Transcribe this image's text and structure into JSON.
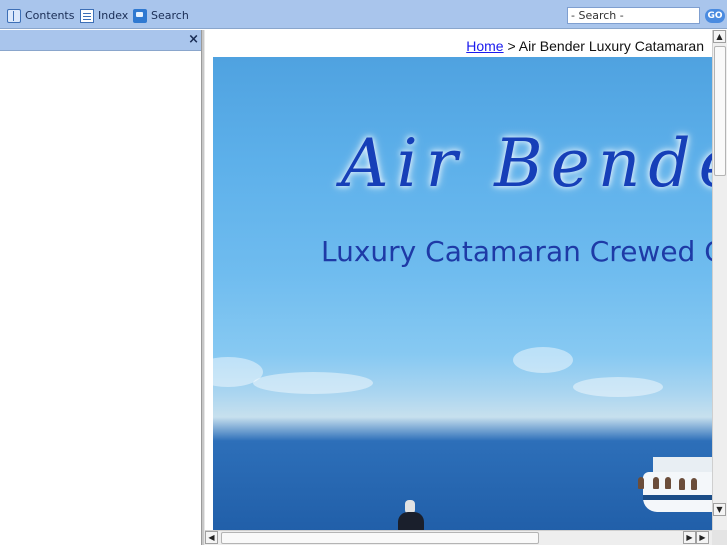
{
  "toolbar": {
    "contents_label": "Contents",
    "index_label": "Index",
    "search_label": "Search",
    "search_placeholder": "- Search -",
    "go_label": "GO"
  },
  "left_panel": {
    "close_symbol": "×"
  },
  "breadcrumb": {
    "home_label": "Home",
    "separator": " > ",
    "current": "Air Bender Luxury Catamaran"
  },
  "hero": {
    "title": "Air Bender",
    "subtitle": "Luxury Catamaran Crewed C"
  },
  "icons": {
    "contents": "book-icon",
    "index": "index-list-icon",
    "search": "search-speech-icon",
    "close": "close-icon"
  },
  "colors": {
    "toolbar_bg": "#a9c5ec",
    "title_blue": "#163fb8",
    "link_blue": "#1a1aee"
  }
}
